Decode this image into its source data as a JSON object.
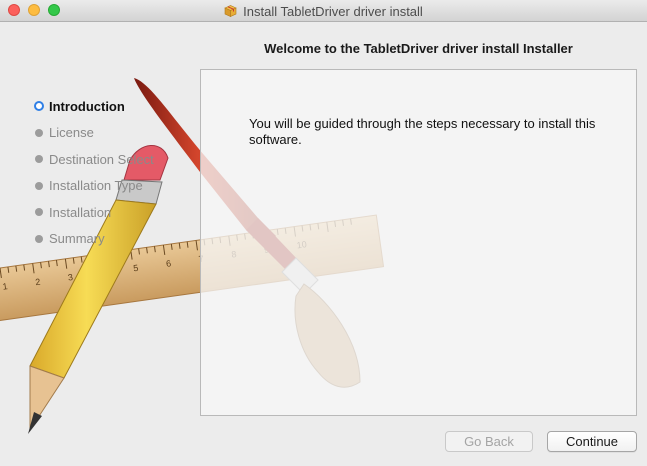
{
  "window": {
    "title": "Install TabletDriver driver install",
    "icon": "package-icon"
  },
  "header": {
    "title": "Welcome to the TabletDriver driver install Installer"
  },
  "steps": [
    {
      "label": "Introduction",
      "active": true
    },
    {
      "label": "License",
      "active": false
    },
    {
      "label": "Destination Select",
      "active": false
    },
    {
      "label": "Installation Type",
      "active": false
    },
    {
      "label": "Installation",
      "active": false
    },
    {
      "label": "Summary",
      "active": false
    }
  ],
  "content": {
    "text": "You will be guided through the steps necessary to install this software."
  },
  "buttons": {
    "back": "Go Back",
    "continue": "Continue"
  },
  "ruler_numbers": [
    "1",
    "2",
    "3",
    "4",
    "5",
    "6",
    "7",
    "8",
    "9",
    "10"
  ],
  "colors": {
    "active_step": "#2f7fe6",
    "pencil_yellow": "#f3cf3e",
    "brush_red": "#b8321f"
  }
}
